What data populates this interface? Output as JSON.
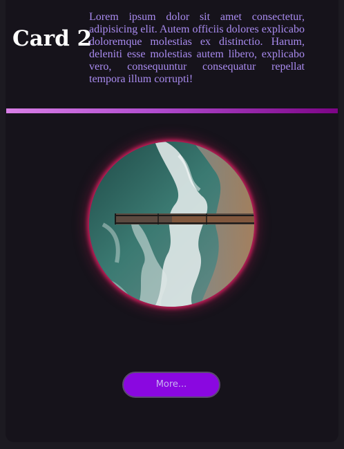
{
  "card": {
    "title": "Card 2",
    "text": "Lorem ipsum dolor sit amet consectetur, adipisicing elit. Autem officiis dolores explicabo doloremque molestias ex distinctio. Harum, deleniti esse molestias autem libero, explicabo vero, consequuntur consequatur repellat tempora illum corrupti!",
    "image": "aerial-ocean-pier-photo",
    "button_label": "More..."
  },
  "colors": {
    "page_background": "#1c1a21",
    "card_background": "#16131b",
    "title": "#ffffff",
    "text": "#a98bf0",
    "accent_gradient_start": "#d87fe6",
    "accent_gradient_end": "#7d0487",
    "image_glow": "#c81e5a",
    "button_background": "#8a08e0",
    "button_text": "#c9b4f2"
  }
}
